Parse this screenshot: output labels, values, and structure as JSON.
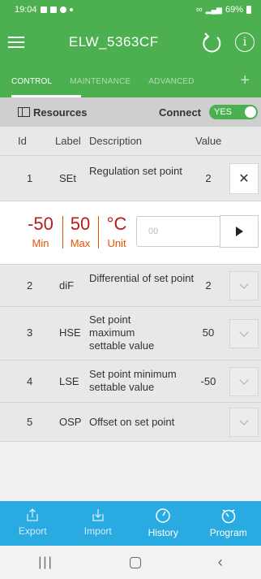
{
  "status": {
    "time": "19:04",
    "battery": "69%"
  },
  "appbar": {
    "title": "ELW_5363CF"
  },
  "tabs": [
    {
      "label": "CONTROL"
    },
    {
      "label": "MAINTENANCE"
    },
    {
      "label": "ADVANCED"
    }
  ],
  "resources": {
    "label": "Resources",
    "connect_label": "Connect",
    "toggle_label": "YES"
  },
  "table": {
    "headers": {
      "id": "Id",
      "label": "Label",
      "description": "Description",
      "value": "Value"
    },
    "rows": [
      {
        "id": "1",
        "label": "SEt",
        "description": "Regulation set point",
        "value": "2"
      },
      {
        "id": "2",
        "label": "diF",
        "description": "Differential of set point",
        "value": "2"
      },
      {
        "id": "3",
        "label": "HSE",
        "description": "Set point maximum settable value",
        "value": "50"
      },
      {
        "id": "4",
        "label": "LSE",
        "description": "Set point minimum settable value",
        "value": "-50"
      },
      {
        "id": "5",
        "label": "OSP",
        "description": "Offset on set point",
        "value": ""
      }
    ]
  },
  "editor": {
    "min_value": "-50",
    "min_label": "Min",
    "max_value": "50",
    "max_label": "Max",
    "unit_value": "°C",
    "unit_label": "Unit",
    "input_placeholder": "00"
  },
  "bottom_nav": [
    {
      "label": "Export",
      "icon": "export-icon"
    },
    {
      "label": "Import",
      "icon": "import-icon"
    },
    {
      "label": "History",
      "icon": "history-icon"
    },
    {
      "label": "Program",
      "icon": "program-icon"
    }
  ]
}
